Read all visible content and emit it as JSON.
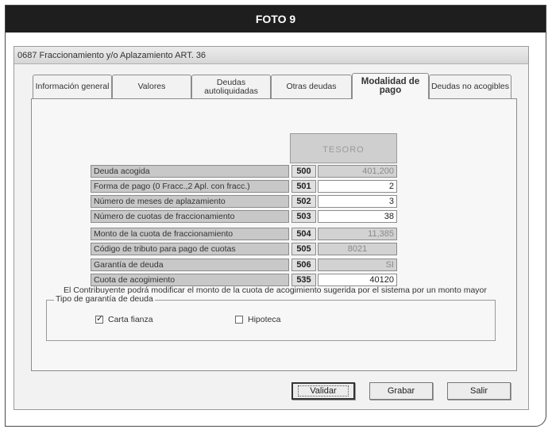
{
  "photo_header": "FOTO 9",
  "window": {
    "title": "0687  Fraccionamiento y/o Aplazamiento ART. 36"
  },
  "tabs": [
    {
      "label": "Información general"
    },
    {
      "label": "Valores"
    },
    {
      "label_line1": "Deudas",
      "label_line2": "autoliquidadas"
    },
    {
      "label": "Otras deudas"
    },
    {
      "label_line1": "Modalidad de",
      "label_line2": "pago"
    },
    {
      "label": "Deudas no acogibles"
    }
  ],
  "column_header": "TESORO",
  "rows": [
    {
      "label": "Deuda acogida",
      "code": "500",
      "value": "401,200"
    },
    {
      "label": "Forma de pago (0 Fracc.,2 Apl. con fracc.)",
      "code": "501",
      "value": "2"
    },
    {
      "label": "Número de meses de aplazamiento",
      "code": "502",
      "value": "3"
    },
    {
      "label": "Número de cuotas de fraccionamiento",
      "code": "503",
      "value": "38"
    },
    {
      "label": "Monto de la cuota de fraccionamiento",
      "code": "504",
      "value": "11,385"
    },
    {
      "label": "Código de tributo para pago de cuotas",
      "code": "505",
      "value": "8021"
    },
    {
      "label": "Garantía de deuda",
      "code": "506",
      "value": "SI"
    },
    {
      "label": "Cuota de acogimiento",
      "code": "535",
      "value": "40120"
    }
  ],
  "note": "El Contribuyente podrá modificar el monto de la cuota de acogimiento sugerida por el sistema por un monto mayor",
  "guarantee_group": {
    "title": "Tipo de garantía de deuda",
    "options": [
      {
        "label": "Carta fianza",
        "checked": true
      },
      {
        "label": "Hipoteca",
        "checked": false
      }
    ]
  },
  "buttons": {
    "validate": "Validar",
    "save": "Grabar",
    "exit": "Salir"
  }
}
